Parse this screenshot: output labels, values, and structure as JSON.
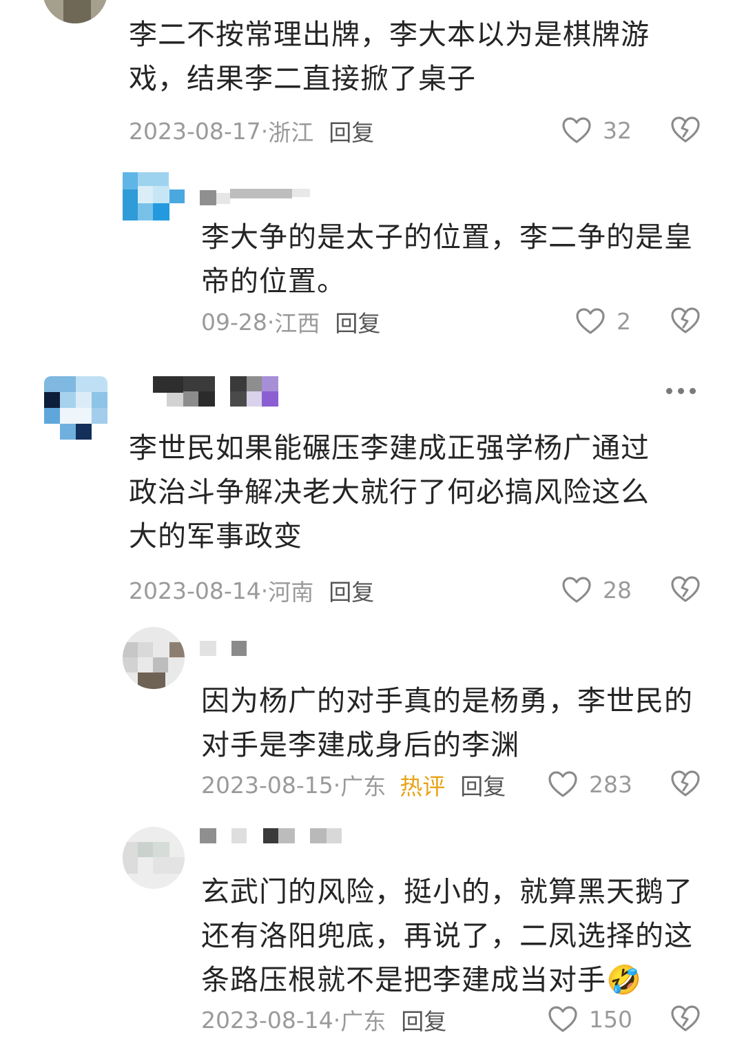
{
  "comments": [
    {
      "text_lines": [
        "李二不按常理出牌，李大本以为是棋牌游",
        "戏，结果李二直接掀了桌子"
      ],
      "date": "2023-08-17",
      "location": "浙江",
      "reply_label": "回复",
      "likes": "32"
    },
    {
      "text_lines": [
        "李大争的是太子的位置，李二争的是皇",
        "帝的位置。"
      ],
      "date": "09-28",
      "location": "江西",
      "reply_label": "回复",
      "likes": "2"
    },
    {
      "text_lines": [
        "李世民如果能碾压李建成正强学杨广通过",
        "政治斗争解决老大就行了何必搞风险这么",
        "大的军事政变"
      ],
      "date": "2023-08-14",
      "location": "河南",
      "reply_label": "回复",
      "likes": "28"
    },
    {
      "text_lines": [
        "因为杨广的对手真的是杨勇，李世民的",
        "对手是李建成身后的李渊"
      ],
      "date": "2023-08-15",
      "location": "广东",
      "badge": "热评",
      "reply_label": "回复",
      "likes": "283"
    },
    {
      "text_lines": [
        "玄武门的风险，挺小的，就算黑天鹅了",
        "还有洛阳兜底，再说了，二凤选择的这",
        "条路压根就不是把李建成当对手🤣"
      ],
      "date": "2023-08-14",
      "location": "广东",
      "reply_label": "回复",
      "likes": "150"
    }
  ],
  "separator": " · ",
  "icons": {
    "like": "heart-outline-icon",
    "dislike": "broken-heart-icon",
    "more": "more-dots-icon"
  },
  "colors": {
    "text": "#252525",
    "meta": "#9a9a9a",
    "hot_badge": "#e8a316"
  }
}
